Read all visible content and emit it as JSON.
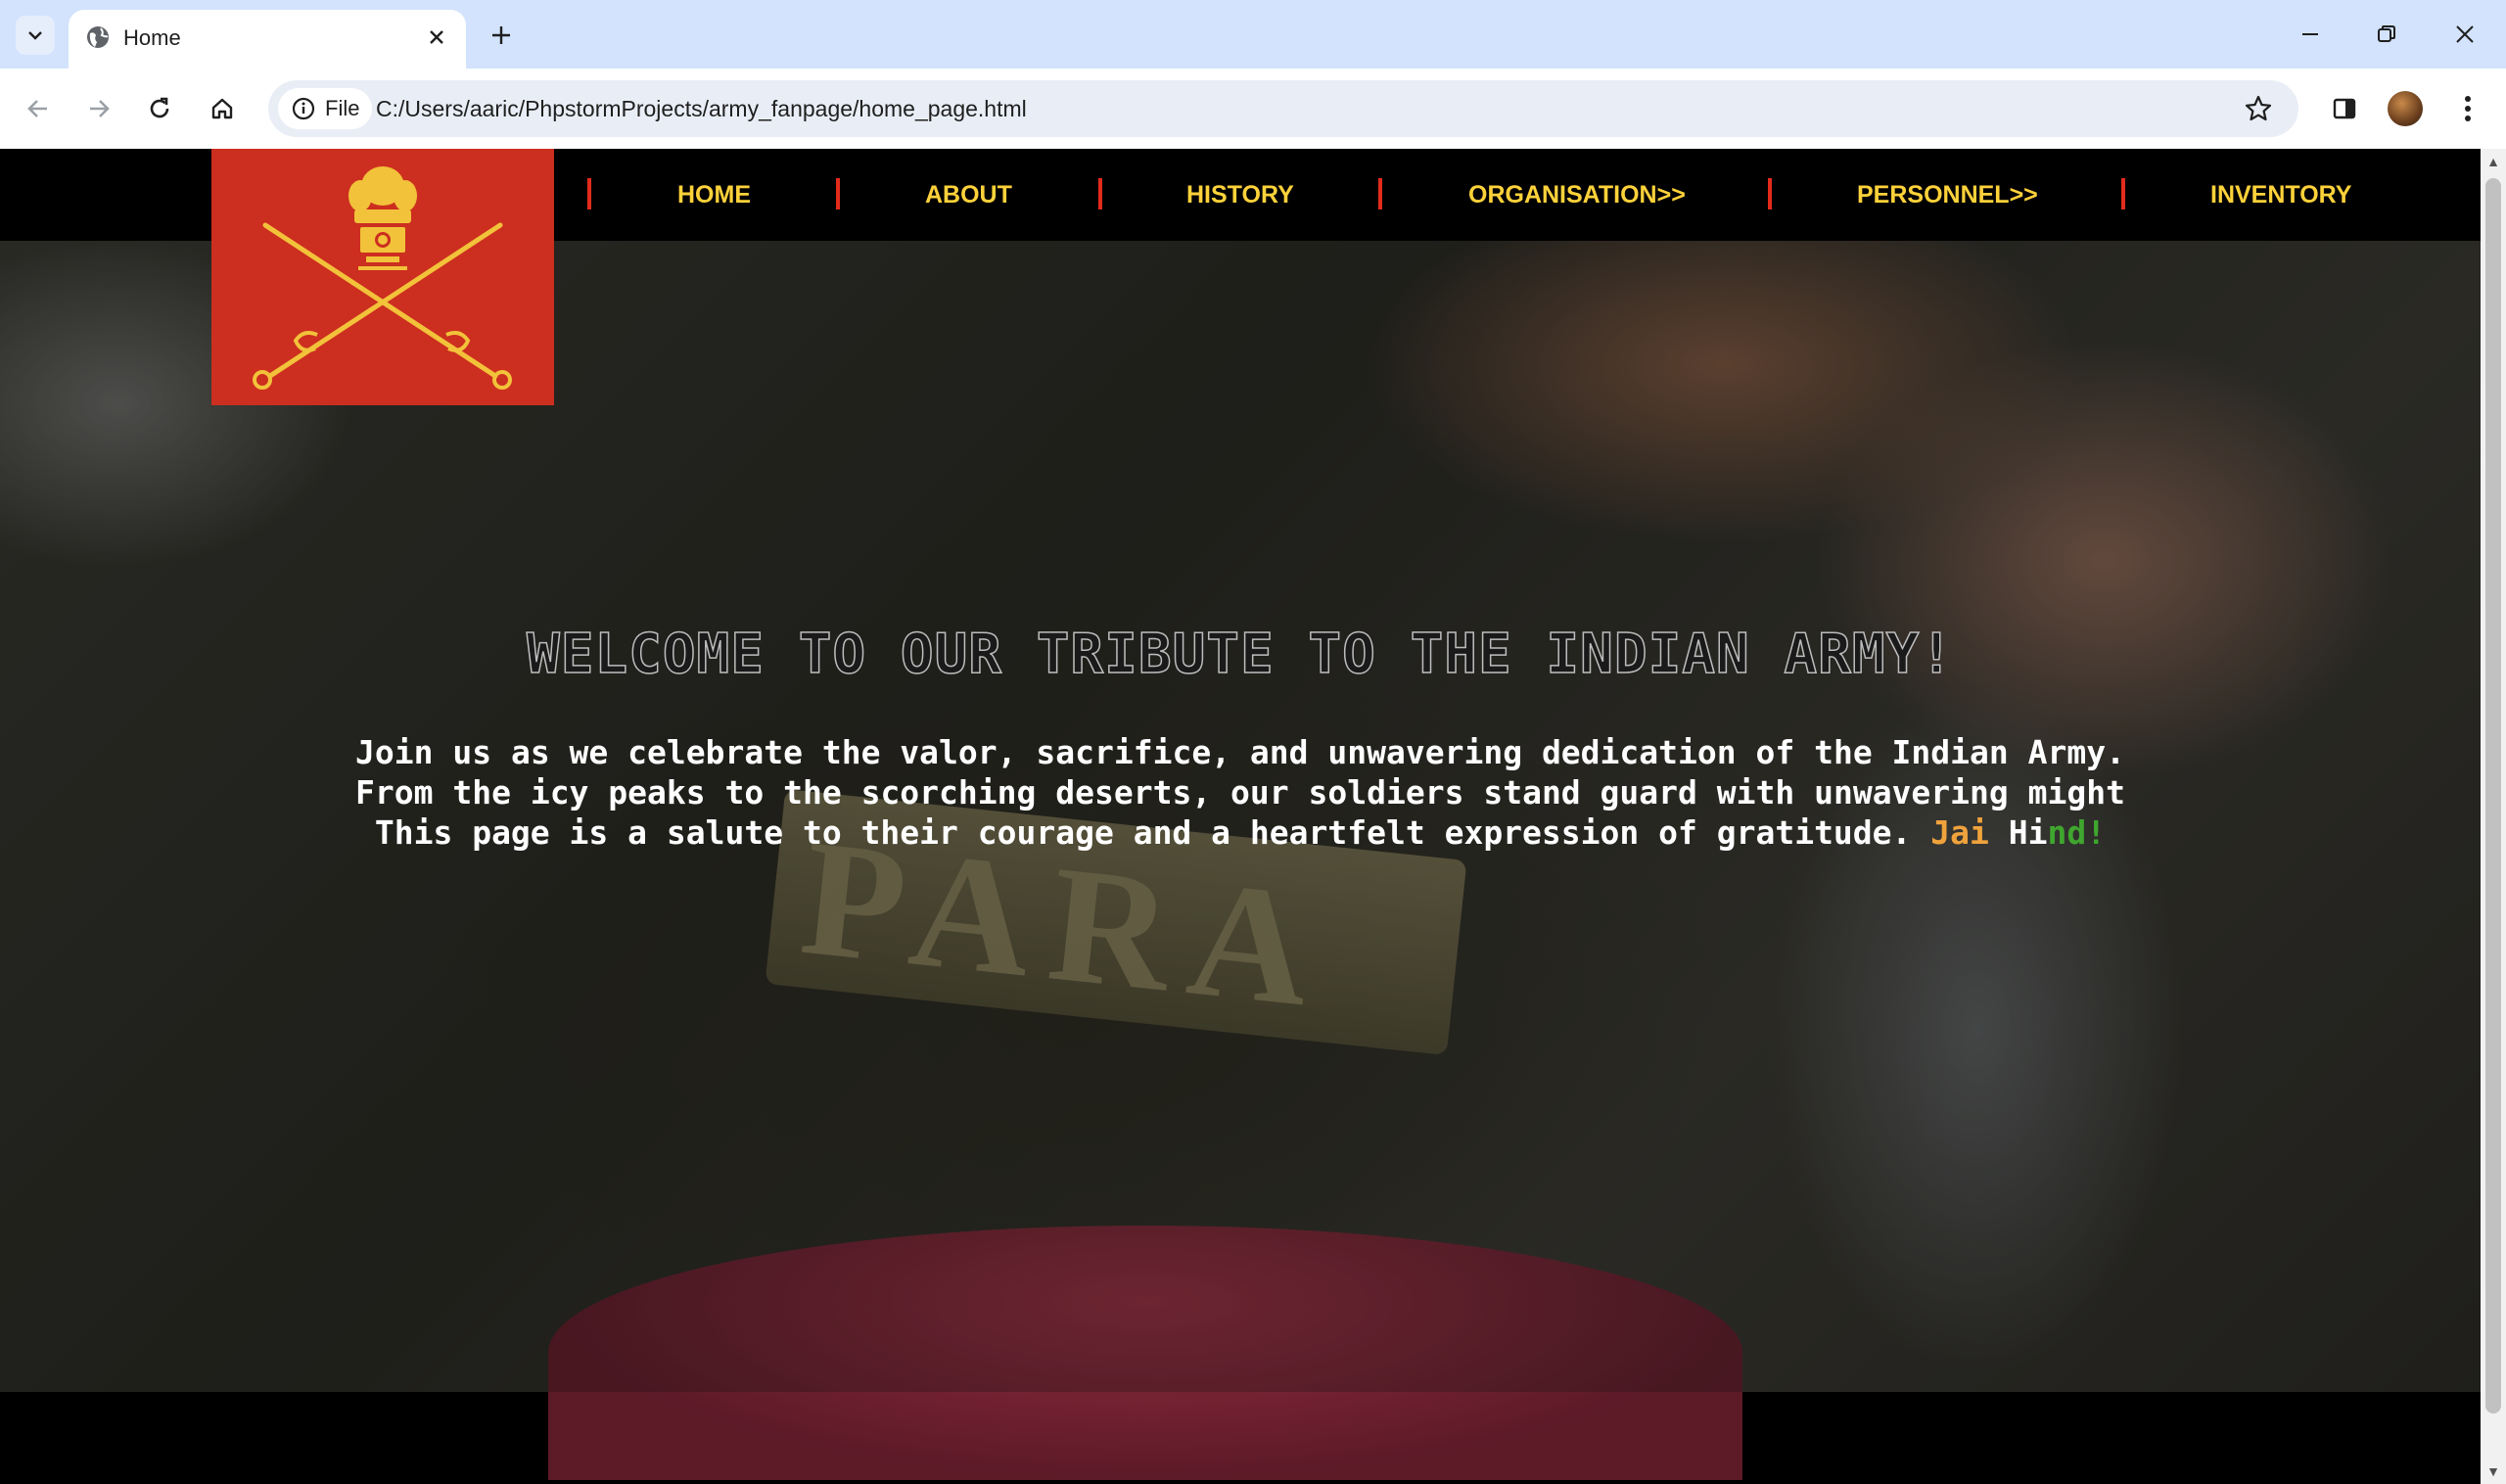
{
  "browser": {
    "tab_title": "Home",
    "address_chip": "File",
    "url": "C:/Users/aaric/PhpstormProjects/army_fanpage/home_page.html"
  },
  "site": {
    "nav": [
      {
        "label": "HOME"
      },
      {
        "label": "ABOUT"
      },
      {
        "label": "HISTORY"
      },
      {
        "label": "ORGANISATION>>"
      },
      {
        "label": "PERSONNEL>>"
      },
      {
        "label": "INVENTORY"
      }
    ],
    "hero": {
      "title": "WELCOME TO OUR TRIBUTE TO THE INDIAN ARMY!",
      "line1": "Join us as we celebrate the valor, sacrifice, and unwavering dedication of the Indian Army.",
      "line2": "From the icy peaks to the scorching deserts, our soldiers stand guard with unwavering might",
      "line3": "This page is a salute to their courage and a heartfelt expression of gratitude. ",
      "jai_saffron": "Jai ",
      "jai_white": "Hi",
      "jai_green": "nd!",
      "badge_text": "PARA"
    }
  },
  "colors": {
    "nav_text": "#ffd23a",
    "nav_separator": "#e32b1c",
    "logo_bg": "#cc2e1f",
    "saffron": "#f0a23c",
    "green": "#3fa62e"
  }
}
